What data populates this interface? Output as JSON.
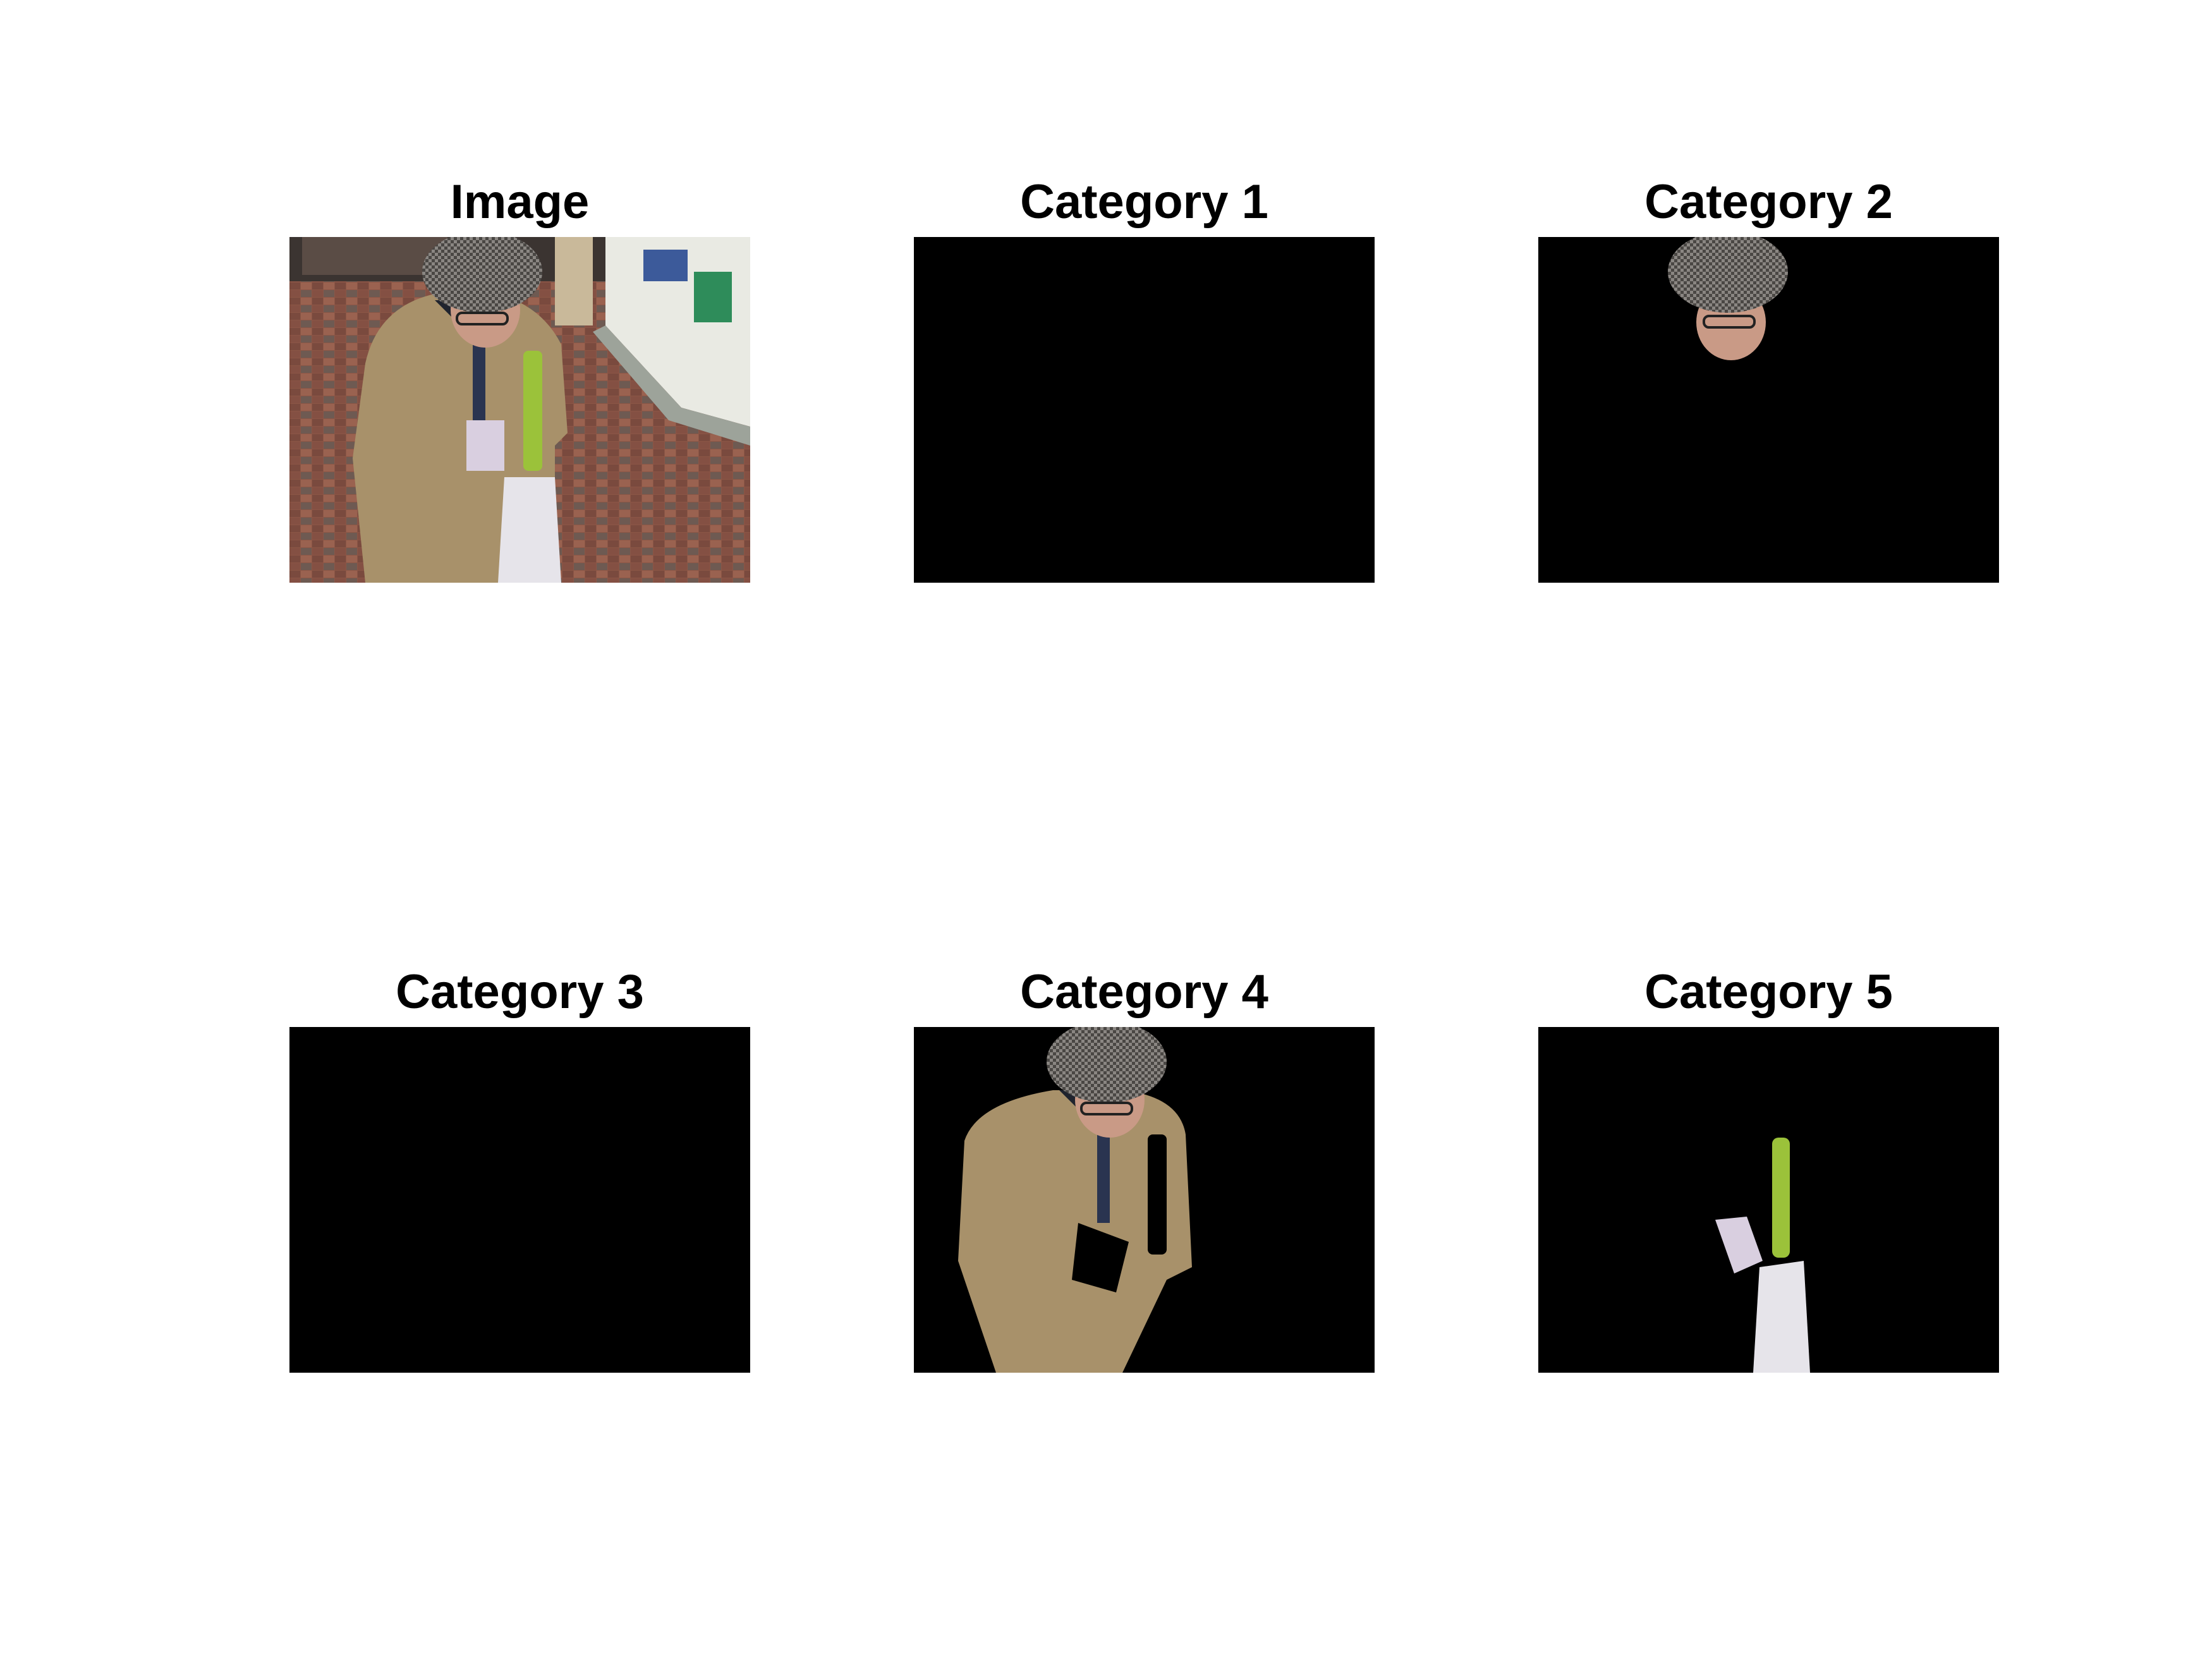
{
  "figure": {
    "panels": [
      {
        "title": "Image",
        "content": "photo-full"
      },
      {
        "title": "Category 1",
        "content": "empty"
      },
      {
        "title": "Category 2",
        "content": "head-hat"
      },
      {
        "title": "Category 3",
        "content": "empty"
      },
      {
        "title": "Category 4",
        "content": "person-body"
      },
      {
        "title": "Category 5",
        "content": "handheld-objects"
      }
    ]
  },
  "colors": {
    "background": "#ffffff",
    "mask": "#000000",
    "coat": "#a8916a",
    "hat": "#7a7672",
    "floor": "#8a5a4a",
    "bag": "#e6e4ea",
    "folder": "#9bc23a"
  }
}
